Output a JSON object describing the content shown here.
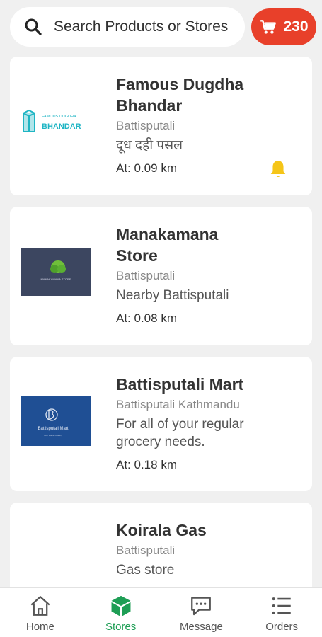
{
  "search": {
    "placeholder": "Search Products or Stores"
  },
  "cart": {
    "count": "230"
  },
  "stores": [
    {
      "name": "Famous Dugdha Bhandar",
      "area": "Battisputali",
      "description": "दूध दही पसल",
      "distance": "At: 0.09 km",
      "logo_text": "BHANDAR",
      "logo_small": "FAMOUS DUGDHA",
      "notification": true
    },
    {
      "name": "Manakamana Store",
      "area": "Battisputali",
      "description": "Nearby Battisputali",
      "distance": "At: 0.08 km",
      "logo_text": "MANAKAMANA STORE",
      "notification": false
    },
    {
      "name": "Battisputali Mart",
      "area": "Battisputali Kathmandu",
      "description": "For all of your regular grocery needs.",
      "distance": "At: 0.18 km",
      "logo_text": "Battisputali Mart",
      "logo_small": "Your Home Grocery",
      "notification": false
    },
    {
      "name": "Koirala Gas",
      "area": "Battisputali",
      "description": "Gas store",
      "distance": "",
      "notification": false
    }
  ],
  "nav": {
    "items": [
      {
        "label": "Home",
        "icon": "home-icon"
      },
      {
        "label": "Stores",
        "icon": "box-icon"
      },
      {
        "label": "Message",
        "icon": "message-icon"
      },
      {
        "label": "Orders",
        "icon": "list-icon"
      }
    ],
    "active": "Stores"
  },
  "colors": {
    "accent_red": "#e8402a",
    "accent_green": "#1e9e55",
    "bell_yellow": "#f5c518",
    "background": "#f0f0f0"
  }
}
